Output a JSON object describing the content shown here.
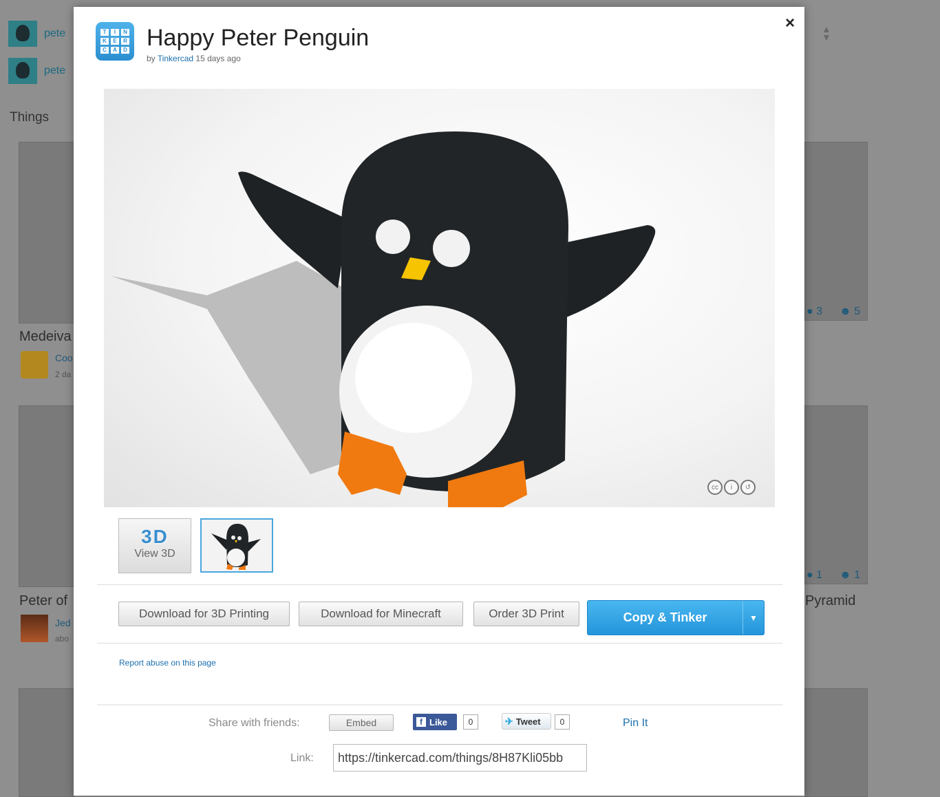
{
  "background": {
    "users": [
      {
        "name": "pete"
      },
      {
        "name": "pete"
      }
    ],
    "section_heading": "Things",
    "cards": [
      {
        "caption": "Medeiva",
        "author": "Coo",
        "time": "2 da"
      },
      {
        "caption": "Peter of",
        "author": "Jed",
        "time": "abo"
      }
    ],
    "right_cards": [
      {
        "comments": "3",
        "likes": "5"
      },
      {
        "comments": "1",
        "likes": "1",
        "caption": "Pyramid"
      }
    ]
  },
  "modal": {
    "close_label": "×",
    "logo_letters": [
      "T",
      "I",
      "N",
      "K",
      "E",
      "R",
      "C",
      "A",
      "D"
    ],
    "title": "Happy Peter Penguin",
    "byline_prefix": "by",
    "author": "Tinkercad",
    "time_ago": "15 days ago",
    "license_icons": [
      "cc",
      "i",
      "↺"
    ],
    "thumbnails": {
      "view3d_big": "3D",
      "view3d_label": "View 3D"
    },
    "actions": {
      "download_3d": "Download for 3D Printing",
      "download_minecraft": "Download for Minecraft",
      "order_print": "Order 3D Print",
      "copy_tinker": "Copy & Tinker",
      "caret": "▼"
    },
    "report_link": "Report abuse on this page",
    "share": {
      "label": "Share with friends:",
      "embed": "Embed",
      "like": "Like",
      "like_count": "0",
      "tweet": "Tweet",
      "tweet_count": "0",
      "pin": "Pin It"
    },
    "link": {
      "label": "Link:",
      "value": "https://tinkercad.com/things/8H87Kli05bb"
    }
  }
}
